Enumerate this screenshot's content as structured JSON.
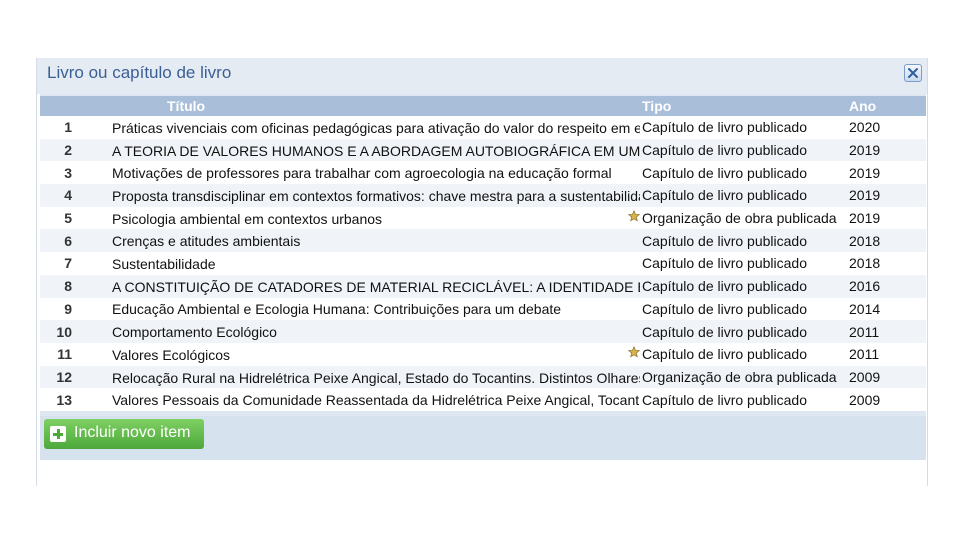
{
  "panel": {
    "title": "Livro ou capítulo de livro",
    "close_icon": "close-icon"
  },
  "table": {
    "columns": {
      "number": "",
      "title": "Título",
      "tipo": "Tipo",
      "ano": "Ano"
    },
    "rows": [
      {
        "num": "1",
        "title": "Práticas vivenciais com oficinas pedagógicas para ativação do valor do respeito em estudantes",
        "tipo": "Capítulo de livro publicado",
        "ano": "2020",
        "starred": false
      },
      {
        "num": "2",
        "title": "A TEORIA DE VALORES HUMANOS E A ABORDAGEM AUTOBIOGRÁFICA EM UMA PESQUISA",
        "tipo": "Capítulo de livro publicado",
        "ano": "2019",
        "starred": false
      },
      {
        "num": "3",
        "title": "Motivações de professores para trabalhar com agroecologia na educação formal",
        "tipo": "Capítulo de livro publicado",
        "ano": "2019",
        "starred": false
      },
      {
        "num": "4",
        "title": "Proposta transdisciplinar em contextos formativos: chave mestra para a sustentabilidade",
        "tipo": "Capítulo de livro publicado",
        "ano": "2019",
        "starred": false
      },
      {
        "num": "5",
        "title": "Psicologia ambiental em contextos urbanos",
        "tipo": "Organização de obra publicada",
        "ano": "2019",
        "starred": true
      },
      {
        "num": "6",
        "title": "Crenças e atitudes ambientais",
        "tipo": "Capítulo de livro publicado",
        "ano": "2018",
        "starred": false
      },
      {
        "num": "7",
        "title": "Sustentabilidade",
        "tipo": "Capítulo de livro publicado",
        "ano": "2018",
        "starred": false
      },
      {
        "num": "8",
        "title": "A CONSTITUIÇÃO DE CATADORES DE MATERIAL RECICLÁVEL: A IDENTIDADE ESTIGMATIZADA",
        "tipo": "Capítulo de livro publicado",
        "ano": "2016",
        "starred": false
      },
      {
        "num": "9",
        "title": "Educação Ambiental e Ecologia Humana: Contribuições para um debate",
        "tipo": "Capítulo de livro publicado",
        "ano": "2014",
        "starred": false
      },
      {
        "num": "10",
        "title": "Comportamento Ecológico",
        "tipo": "Capítulo de livro publicado",
        "ano": "2011",
        "starred": false
      },
      {
        "num": "11",
        "title": "Valores Ecológicos",
        "tipo": "Capítulo de livro publicado",
        "ano": "2011",
        "starred": true
      },
      {
        "num": "12",
        "title": "Relocação Rural na Hidrelétrica Peixe Angical, Estado do Tocantins. Distintos Olhares da Sustentabilidade",
        "tipo": "Organização de obra publicada",
        "ano": "2009",
        "starred": false
      },
      {
        "num": "13",
        "title": "Valores Pessoais da Comunidade Reassentada da Hidrelétrica Peixe Angical, Tocantins",
        "tipo": "Capítulo de livro publicado",
        "ano": "2009",
        "starred": false
      }
    ]
  },
  "footer": {
    "add_button_label": "Incluir novo item",
    "add_icon": "plus-icon"
  },
  "colors": {
    "header_bg": "#a9bed9",
    "title_color": "#3b5f95",
    "add_button": "#4da83b",
    "star": "#d8b34a"
  }
}
